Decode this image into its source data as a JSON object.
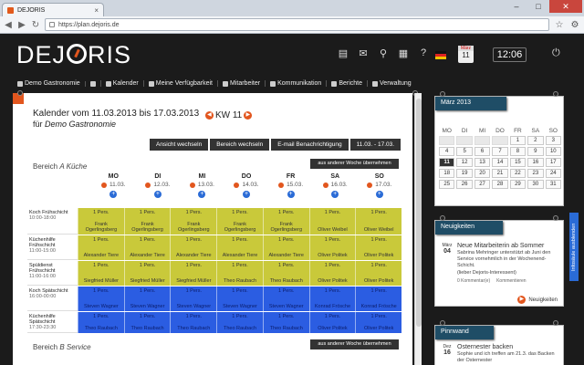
{
  "browser": {
    "tab_title": "DEJORIS",
    "url": "https://plan.dejoris.de"
  },
  "app": {
    "logo": "DEJORIS",
    "clock": "12:06",
    "calendar_icon": {
      "month": "März",
      "day": "11"
    }
  },
  "menu": [
    {
      "label": "Demo Gastronomie",
      "icon": "flag-icon"
    },
    {
      "label": "",
      "icon": "home-icon"
    },
    {
      "label": "Kalender",
      "icon": "calendar-icon"
    },
    {
      "label": "Meine Verfügbarkeit",
      "icon": "availability-icon"
    },
    {
      "label": "Mitarbeiter",
      "icon": "users-icon"
    },
    {
      "label": "Kommunikation",
      "icon": "chat-icon"
    },
    {
      "label": "Berichte",
      "icon": "report-icon"
    },
    {
      "label": "Verwaltung",
      "icon": "tools-icon"
    }
  ],
  "main": {
    "title": "Kalender vom 11.03.2013 bis 17.03.2013",
    "kw": "KW 11",
    "subtitle_prefix": "für",
    "subtitle_company": "Demo Gastronomie",
    "buttons": [
      "Ansicht wechseln",
      "Bereich wechseln",
      "E-mail Benachrichtigung",
      "11.03. - 17.03."
    ],
    "copy_week_label": "aus anderer Woche übernehmen",
    "section_a_prefix": "Bereich",
    "section_a_name": "A Küche",
    "section_b_prefix": "Bereich",
    "section_b_name": "B Service",
    "days": [
      {
        "name": "MO",
        "date": "11.03."
      },
      {
        "name": "DI",
        "date": "12.03."
      },
      {
        "name": "MI",
        "date": "13.03."
      },
      {
        "name": "DO",
        "date": "14.03."
      },
      {
        "name": "FR",
        "date": "15.03."
      },
      {
        "name": "SA",
        "date": "16.03."
      },
      {
        "name": "SO",
        "date": "17.03."
      }
    ],
    "shifts": [
      {
        "name": "Koch Frühschicht",
        "time": "10:00-18:00",
        "color": "y",
        "cells": [
          [
            "1 Pers.",
            "Frank Ogerlingsberg"
          ],
          [
            "1 Pers.",
            "Frank Ogerlingsberg"
          ],
          [
            "1 Pers.",
            "Frank Ogerlingsberg"
          ],
          [
            "1 Pers.",
            "Frank Ogerlingsberg"
          ],
          [
            "1 Pers.",
            "Frank Ogerlingsberg"
          ],
          [
            "1 Pers.",
            "Oliver Weibel"
          ],
          [
            "1 Pers.",
            "Oliver Weibel"
          ]
        ]
      },
      {
        "name": "Küchenhilfe Frühschicht",
        "time": "11:00-15:00",
        "color": "y",
        "cells": [
          [
            "1 Pers.",
            "Alexander Tiere"
          ],
          [
            "1 Pers.",
            "Alexander Tiere"
          ],
          [
            "1 Pers.",
            "Alexander Tiere"
          ],
          [
            "1 Pers.",
            "Alexander Tiere"
          ],
          [
            "1 Pers.",
            "Alexander Tiere"
          ],
          [
            "1 Pers.",
            "Oliver Politek"
          ],
          [
            "1 Pers.",
            "Oliver Politek"
          ]
        ]
      },
      {
        "name": "Spüldienst Frühschicht",
        "time": "11:00-16:00",
        "color": "y",
        "cells": [
          [
            "1 Pers.",
            "Siegfried Müller"
          ],
          [
            "1 Pers.",
            "Siegfried Müller"
          ],
          [
            "1 Pers.",
            "Siegfried Müller"
          ],
          [
            "1 Pers.",
            "Theo Raubach"
          ],
          [
            "1 Pers.",
            "Theo Raubach"
          ],
          [
            "1 Pers.",
            "Oliver Politek"
          ],
          [
            "1 Pers.",
            "Oliver Politek"
          ]
        ]
      },
      {
        "name": "Koch Spätschicht",
        "time": "16:00-00:00",
        "color": "b",
        "cells": [
          [
            "1 Pers.",
            "Steven Wagner"
          ],
          [
            "1 Pers.",
            "Steven Wagner"
          ],
          [
            "1 Pers.",
            "Steven Wagner"
          ],
          [
            "1 Pers.",
            "Steven Wagner"
          ],
          [
            "1 Pers.",
            "Steven Wagner"
          ],
          [
            "1 Pers.",
            "Konrad Frösche"
          ],
          [
            "1 Pers.",
            "Konrad Frösche"
          ]
        ]
      },
      {
        "name": "Küchenhilfe Spätschicht",
        "time": "17:30-23:30",
        "color": "b",
        "cells": [
          [
            "1 Pers.",
            "Theo Raubach"
          ],
          [
            "1 Pers.",
            "Theo Raubach"
          ],
          [
            "1 Pers.",
            "Theo Raubach"
          ],
          [
            "1 Pers.",
            "Theo Raubach"
          ],
          [
            "1 Pers.",
            "Theo Raubach"
          ],
          [
            "1 Pers.",
            "Oliver Politek"
          ],
          [
            "1 Pers.",
            "Oliver Politek"
          ]
        ]
      }
    ]
  },
  "sidebar": {
    "month_title": "März 2013",
    "weekdays": [
      "MO",
      "DI",
      "MI",
      "DO",
      "FR",
      "SA",
      "SO"
    ],
    "weeks": [
      [
        "",
        "",
        "",
        "",
        "1",
        "2",
        "3"
      ],
      [
        "4",
        "5",
        "6",
        "7",
        "8",
        "9",
        "10"
      ],
      [
        "11",
        "12",
        "13",
        "14",
        "15",
        "16",
        "17"
      ],
      [
        "18",
        "19",
        "20",
        "21",
        "22",
        "23",
        "24"
      ],
      [
        "25",
        "26",
        "27",
        "28",
        "29",
        "30",
        "31"
      ]
    ],
    "today": "11",
    "news_title": "Neuigkeiten",
    "news_item": {
      "month": "März",
      "day": "04",
      "title": "Neue Mitarbeiterin ab Sommer",
      "text": "Sabrina Mehringer unterstützt ab Juni den Service vornehmlich in der Wochenend-Schicht.",
      "author": "(lieber Dejoris-Interessent)",
      "comments": "0 Kommentar(e)",
      "comment_link": "Kommentieren"
    },
    "news_more": "Neuigkeiten",
    "pinwand_title": "Pinnwand",
    "pin_item": {
      "month": "Dez",
      "day": "16",
      "title": "Osternester backen",
      "text": "Sophie und ich treffen am 21.3. das Backen der Osternester"
    },
    "info_tab": "Infosäule ausblenden"
  },
  "colors": {
    "accent": "#e2561e",
    "kitchen_early": "#c9c93a",
    "kitchen_late": "#2b5de2",
    "dark": "#1b1b1b",
    "panel_header": "#1f4d66"
  }
}
